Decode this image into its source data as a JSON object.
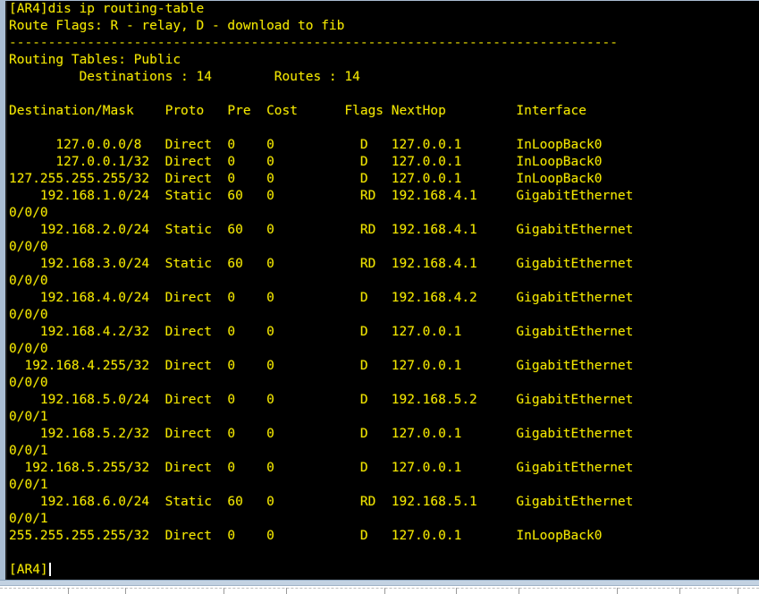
{
  "window": {
    "kind": "router-cli-terminal",
    "device_prompt": "[AR4]",
    "colors": {
      "background": "#000000",
      "text": "#f2e600",
      "cursor": "#ffffff",
      "window_border": "#aabdd2",
      "strip_band": "#c3d2e2"
    }
  },
  "terminal": {
    "clipped_top_line": "[AR4]",
    "command_line": "[AR4]dis ip routing-table",
    "route_flags_line": "Route Flags: R - relay, D - download to fib",
    "separator": "------------------------------------------------------------------------------",
    "routing_tables_line": "Routing Tables: Public",
    "summary_line": "         Destinations : 14        Routes : 14",
    "blank": "",
    "prompt_line": "[AR4]"
  },
  "table": {
    "header_line": "Destination/Mask    Proto   Pre  Cost      Flags NextHop         Interface",
    "columns": [
      "Destination/Mask",
      "Proto",
      "Pre",
      "Cost",
      "Flags",
      "NextHop",
      "Interface"
    ],
    "counts": {
      "destinations": "14",
      "routes": "14"
    },
    "rows": [
      {
        "line": "      127.0.0.0/8   Direct  0    0           D   127.0.0.1       InLoopBack0",
        "destination": "127.0.0.0/8",
        "proto": "Direct",
        "pre": "0",
        "cost": "0",
        "flags": "D",
        "nexthop": "127.0.0.1",
        "interface": "InLoopBack0",
        "wrap": ""
      },
      {
        "line": "      127.0.0.1/32  Direct  0    0           D   127.0.0.1       InLoopBack0",
        "destination": "127.0.0.1/32",
        "proto": "Direct",
        "pre": "0",
        "cost": "0",
        "flags": "D",
        "nexthop": "127.0.0.1",
        "interface": "InLoopBack0",
        "wrap": ""
      },
      {
        "line": "127.255.255.255/32  Direct  0    0           D   127.0.0.1       InLoopBack0",
        "destination": "127.255.255.255/32",
        "proto": "Direct",
        "pre": "0",
        "cost": "0",
        "flags": "D",
        "nexthop": "127.0.0.1",
        "interface": "InLoopBack0",
        "wrap": ""
      },
      {
        "line": "    192.168.1.0/24  Static  60   0           RD  192.168.4.1     GigabitEthernet",
        "destination": "192.168.1.0/24",
        "proto": "Static",
        "pre": "60",
        "cost": "0",
        "flags": "RD",
        "nexthop": "192.168.4.1",
        "interface": "GigabitEthernet",
        "wrap": "0/0/0"
      },
      {
        "line": "    192.168.2.0/24  Static  60   0           RD  192.168.4.1     GigabitEthernet",
        "destination": "192.168.2.0/24",
        "proto": "Static",
        "pre": "60",
        "cost": "0",
        "flags": "RD",
        "nexthop": "192.168.4.1",
        "interface": "GigabitEthernet",
        "wrap": "0/0/0"
      },
      {
        "line": "    192.168.3.0/24  Static  60   0           RD  192.168.4.1     GigabitEthernet",
        "destination": "192.168.3.0/24",
        "proto": "Static",
        "pre": "60",
        "cost": "0",
        "flags": "RD",
        "nexthop": "192.168.4.1",
        "interface": "GigabitEthernet",
        "wrap": "0/0/0"
      },
      {
        "line": "    192.168.4.0/24  Direct  0    0           D   192.168.4.2     GigabitEthernet",
        "destination": "192.168.4.0/24",
        "proto": "Direct",
        "pre": "0",
        "cost": "0",
        "flags": "D",
        "nexthop": "192.168.4.2",
        "interface": "GigabitEthernet",
        "wrap": "0/0/0"
      },
      {
        "line": "    192.168.4.2/32  Direct  0    0           D   127.0.0.1       GigabitEthernet",
        "destination": "192.168.4.2/32",
        "proto": "Direct",
        "pre": "0",
        "cost": "0",
        "flags": "D",
        "nexthop": "127.0.0.1",
        "interface": "GigabitEthernet",
        "wrap": "0/0/0"
      },
      {
        "line": "  192.168.4.255/32  Direct  0    0           D   127.0.0.1       GigabitEthernet",
        "destination": "192.168.4.255/32",
        "proto": "Direct",
        "pre": "0",
        "cost": "0",
        "flags": "D",
        "nexthop": "127.0.0.1",
        "interface": "GigabitEthernet",
        "wrap": "0/0/0"
      },
      {
        "line": "    192.168.5.0/24  Direct  0    0           D   192.168.5.2     GigabitEthernet",
        "destination": "192.168.5.0/24",
        "proto": "Direct",
        "pre": "0",
        "cost": "0",
        "flags": "D",
        "nexthop": "192.168.5.2",
        "interface": "GigabitEthernet",
        "wrap": "0/0/1"
      },
      {
        "line": "    192.168.5.2/32  Direct  0    0           D   127.0.0.1       GigabitEthernet",
        "destination": "192.168.5.2/32",
        "proto": "Direct",
        "pre": "0",
        "cost": "0",
        "flags": "D",
        "nexthop": "127.0.0.1",
        "interface": "GigabitEthernet",
        "wrap": "0/0/1"
      },
      {
        "line": "  192.168.5.255/32  Direct  0    0           D   127.0.0.1       GigabitEthernet",
        "destination": "192.168.5.255/32",
        "proto": "Direct",
        "pre": "0",
        "cost": "0",
        "flags": "D",
        "nexthop": "127.0.0.1",
        "interface": "GigabitEthernet",
        "wrap": "0/0/1"
      },
      {
        "line": "    192.168.6.0/24  Static  60   0           RD  192.168.5.1     GigabitEthernet",
        "destination": "192.168.6.0/24",
        "proto": "Static",
        "pre": "60",
        "cost": "0",
        "flags": "RD",
        "nexthop": "192.168.5.1",
        "interface": "GigabitEthernet",
        "wrap": "0/0/1"
      },
      {
        "line": "255.255.255.255/32  Direct  0    0           D   127.0.0.1       InLoopBack0",
        "destination": "255.255.255.255/32",
        "proto": "Direct",
        "pre": "0",
        "cost": "0",
        "flags": "D",
        "nexthop": "127.0.0.1",
        "interface": "InLoopBack0",
        "wrap": ""
      }
    ]
  },
  "bottom_strip": {
    "divider_positions": [
      76,
      140,
      250,
      320,
      430,
      510,
      580,
      690,
      760,
      825
    ]
  }
}
